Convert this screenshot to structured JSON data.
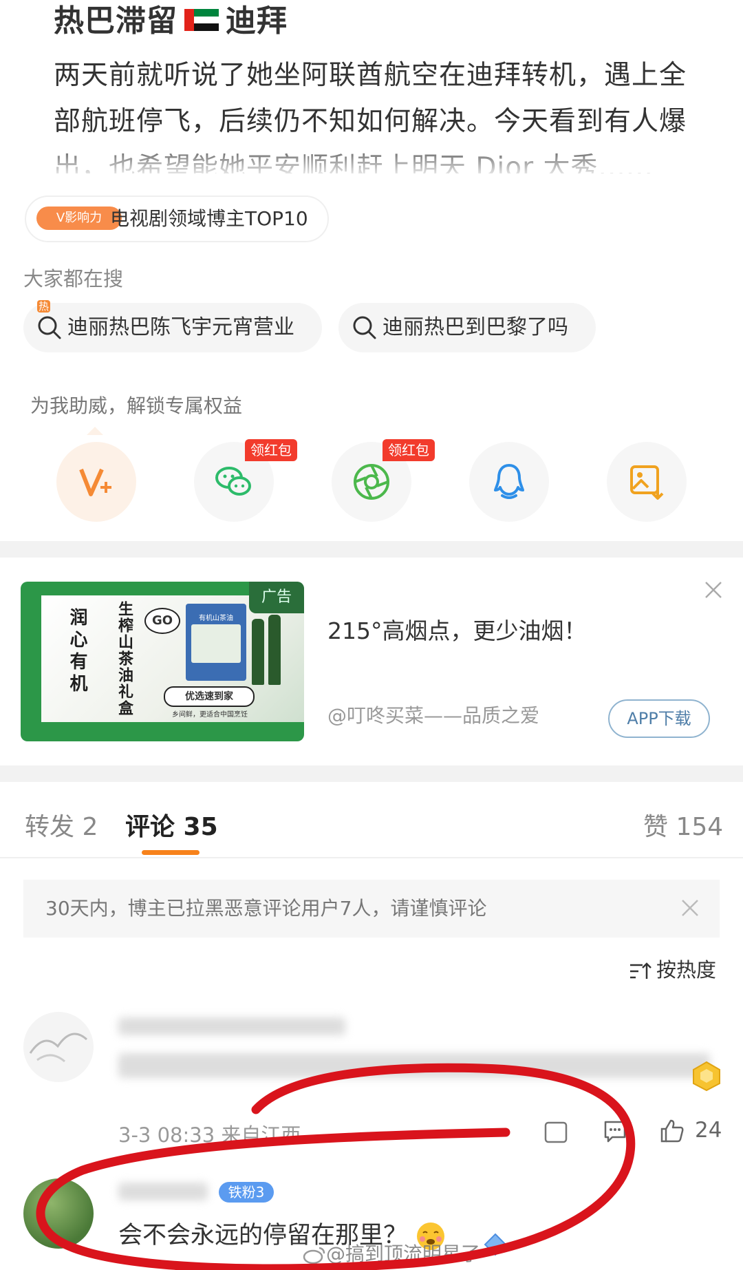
{
  "post": {
    "title_before": "热巴滞留",
    "title_after": "迪拜",
    "flag_icon": "uae-flag-icon",
    "body": "两天前就听说了她坐阿联酋航空在迪拜转机，遇上全部航班停飞，后续仍不知如何解决。今天看到有人爆出，也希望能她平安顺利赶上明天 Dior 大秀......"
  },
  "influence": {
    "tag": "V影响力",
    "text": "电视剧领域博主TOP10"
  },
  "searches": {
    "title": "大家都在搜",
    "items": [
      {
        "label": "迪丽热巴陈飞宇元宵营业",
        "hot": "热"
      },
      {
        "label": "迪丽热巴到巴黎了吗"
      }
    ]
  },
  "support": {
    "title": "为我助威，解锁专属权益",
    "share_items": [
      {
        "icon": "vplus-icon"
      },
      {
        "icon": "wechat-icon",
        "badge": "领红包"
      },
      {
        "icon": "moments-icon",
        "badge": "领红包"
      },
      {
        "icon": "qq-icon"
      },
      {
        "icon": "save-image-icon"
      }
    ]
  },
  "ad": {
    "tag": "广告",
    "headline": "215°高烟点，更少油烟！",
    "source": "@叮咚买菜——品质之爱",
    "cta": "APP下载",
    "image_texts": {
      "left": "润心有机",
      "middle": "生榨山茶油礼盒",
      "go": "GO",
      "product": "有机山茶油",
      "button": "优选速到家",
      "caption": "乡间鲜，更适合中国烹饪"
    }
  },
  "tabs": {
    "repost": "转发 2",
    "comments": "评论 35",
    "likes": "赞 154"
  },
  "notice": {
    "text": "30天内，博主已拉黑恶意评论用户7人，请谨慎评论"
  },
  "sort": {
    "label": "按热度"
  },
  "comments": [
    {
      "time_location": "3-3 08:33 来自江西",
      "likes": "24"
    },
    {
      "fan_badge": "铁粉3",
      "text": "会不会永远的停留在那里？"
    }
  ],
  "watermark": "@搞到顶流明星了",
  "colors": {
    "accent_orange": "#f7821b",
    "red_badge": "#f23b2c",
    "ad_green": "#2c9748",
    "annotation_red": "#d9141c"
  }
}
